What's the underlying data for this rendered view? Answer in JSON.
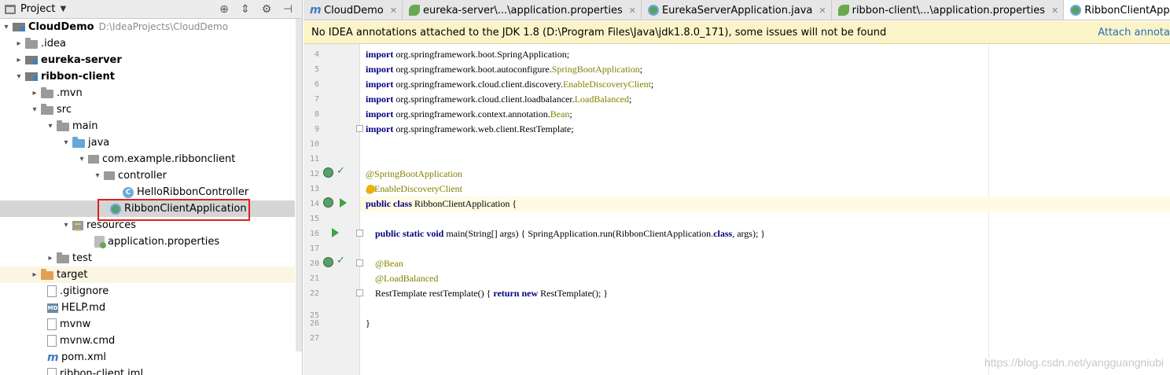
{
  "project_panel": {
    "title": "Project",
    "tools": [
      "crosshair-icon",
      "collapse-icon",
      "gear-icon",
      "hide-icon"
    ],
    "tree": [
      {
        "label": "CloudDemo",
        "path": "D:\\IdeaProjects\\CloudDemo",
        "icon": "module-icon",
        "arrow": "down",
        "bold": true
      },
      {
        "label": ".idea",
        "icon": "folder-icon",
        "arrow": "right"
      },
      {
        "label": "eureka-server",
        "icon": "module-icon",
        "arrow": "right",
        "bold": true
      },
      {
        "label": "ribbon-client",
        "icon": "module-icon",
        "arrow": "down",
        "bold": true
      },
      {
        "label": ".mvn",
        "icon": "folder-icon",
        "arrow": "right"
      },
      {
        "label": "src",
        "icon": "folder-icon",
        "arrow": "down"
      },
      {
        "label": "main",
        "icon": "folder-icon",
        "arrow": "down"
      },
      {
        "label": "java",
        "icon": "source-folder-icon",
        "arrow": "down"
      },
      {
        "label": "com.example.ribbonclient",
        "icon": "package-icon",
        "arrow": "down"
      },
      {
        "label": "controller",
        "icon": "package-icon",
        "arrow": "down"
      },
      {
        "label": "HelloRibbonController",
        "icon": "class-icon",
        "arrow": "none"
      },
      {
        "label": "RibbonClientApplication",
        "icon": "spring-boot-class-icon",
        "arrow": "none",
        "selected": true
      },
      {
        "label": "resources",
        "icon": "resources-folder-icon",
        "arrow": "down"
      },
      {
        "label": "application.properties",
        "icon": "properties-file-icon",
        "arrow": "none"
      },
      {
        "label": "test",
        "icon": "folder-icon",
        "arrow": "right"
      },
      {
        "label": "target",
        "icon": "excluded-folder-icon",
        "arrow": "right"
      },
      {
        "label": ".gitignore",
        "icon": "file-icon",
        "arrow": "none"
      },
      {
        "label": "HELP.md",
        "icon": "markdown-icon",
        "arrow": "none"
      },
      {
        "label": "mvnw",
        "icon": "file-icon",
        "arrow": "none"
      },
      {
        "label": "mvnw.cmd",
        "icon": "file-icon",
        "arrow": "none"
      },
      {
        "label": "pom.xml",
        "icon": "maven-icon",
        "arrow": "none"
      },
      {
        "label": "ribbon-client.iml",
        "icon": "file-icon",
        "arrow": "none"
      }
    ]
  },
  "tabs": [
    {
      "label": "CloudDemo",
      "icon": "maven-icon"
    },
    {
      "label": "eureka-server\\...\\application.properties",
      "icon": "leaf-icon"
    },
    {
      "label": "EurekaServerApplication.java",
      "icon": "spring-boot-class-icon"
    },
    {
      "label": "ribbon-client\\...\\application.properties",
      "icon": "leaf-icon"
    },
    {
      "label": "RibbonClientApplication.java",
      "icon": "spring-boot-class-icon",
      "active": true
    }
  ],
  "banner": {
    "message": "No IDEA annotations attached to the JDK 1.8 (D:\\Program Files\\Java\\jdk1.8.0_171), some issues will not be found",
    "link": "Attach annota"
  },
  "editor": {
    "current_line": 14,
    "lines": [
      {
        "n": "4",
        "code": "import org.springframework.boot.SpringApplication;"
      },
      {
        "n": "5",
        "code": "import org.springframework.boot.autoconfigure.SpringBootApplication;"
      },
      {
        "n": "6",
        "code": "import org.springframework.cloud.client.discovery.EnableDiscoveryClient;"
      },
      {
        "n": "7",
        "code": "import org.springframework.cloud.client.loadbalancer.LoadBalanced;"
      },
      {
        "n": "8",
        "code": "import org.springframework.context.annotation.Bean;"
      },
      {
        "n": "9",
        "code": "import org.springframework.web.client.RestTemplate;"
      },
      {
        "n": "10",
        "code": ""
      },
      {
        "n": "11",
        "code": ""
      },
      {
        "n": "12",
        "code": "@SpringBootApplication"
      },
      {
        "n": "13",
        "code": "@EnableDiscoveryClient"
      },
      {
        "n": "14",
        "code": "public class RibbonClientApplication {"
      },
      {
        "n": "15",
        "code": ""
      },
      {
        "n": "16",
        "code": "    public static void main(String[] args) { SpringApplication.run(RibbonClientApplication.class, args); }"
      },
      {
        "n": "17",
        "code": ""
      },
      {
        "n": "20",
        "code": "    @Bean"
      },
      {
        "n": "21",
        "code": "    @LoadBalanced"
      },
      {
        "n": "22",
        "code": "    RestTemplate restTemplate() { return new RestTemplate(); }"
      },
      {
        "n": "25",
        "code": ""
      },
      {
        "n": "26",
        "code": "}"
      },
      {
        "n": "27",
        "code": ""
      }
    ]
  },
  "watermark": "https://blog.csdn.net/yangguangniubi"
}
